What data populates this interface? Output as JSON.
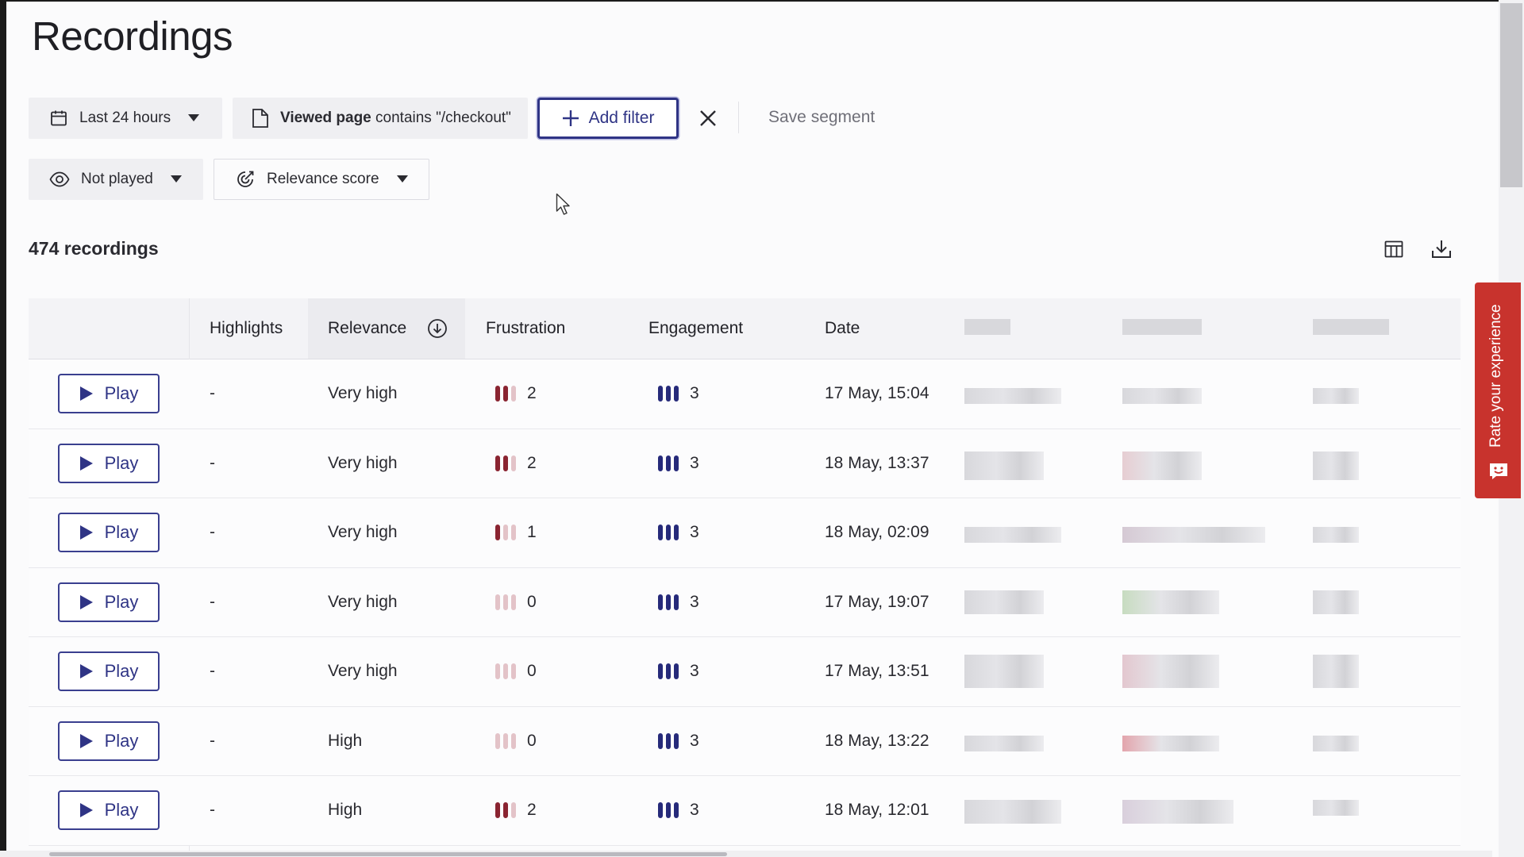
{
  "page": {
    "title": "Recordings"
  },
  "filters": {
    "date_range": "Last 24 hours",
    "page_filter": {
      "label": "Viewed page",
      "rest": " contains \"/checkout\""
    },
    "add_filter": "Add filter",
    "save_segment": "Save segment",
    "played_state": "Not played",
    "sort": "Relevance score"
  },
  "results": {
    "count_label": "474 recordings"
  },
  "table": {
    "columns": {
      "highlights": "Highlights",
      "relevance": "Relevance",
      "frustration": "Frustration",
      "engagement": "Engagement",
      "date": "Date"
    },
    "play_label": "Play",
    "rows": [
      {
        "highlights": "-",
        "relevance": "Very high",
        "frustration": "2",
        "engagement": "3",
        "date": "17 May, 15:04"
      },
      {
        "highlights": "-",
        "relevance": "Very high",
        "frustration": "2",
        "engagement": "3",
        "date": "18 May, 13:37"
      },
      {
        "highlights": "-",
        "relevance": "Very high",
        "frustration": "1",
        "engagement": "3",
        "date": "18 May, 02:09"
      },
      {
        "highlights": "-",
        "relevance": "Very high",
        "frustration": "0",
        "engagement": "3",
        "date": "17 May, 19:07"
      },
      {
        "highlights": "-",
        "relevance": "Very high",
        "frustration": "0",
        "engagement": "3",
        "date": "17 May, 13:51"
      },
      {
        "highlights": "-",
        "relevance": "High",
        "frustration": "0",
        "engagement": "3",
        "date": "18 May, 13:22"
      },
      {
        "highlights": "-",
        "relevance": "High",
        "frustration": "2",
        "engagement": "3",
        "date": "18 May, 12:01"
      }
    ]
  },
  "feedback": {
    "label": "Rate your experience"
  },
  "colors": {
    "accent": "#2f3485",
    "frustration_bar": "#8a2431",
    "frustration_bar_off": "#e3c3c8",
    "engagement_bar": "#262a7a",
    "feedback_tab": "#c8332d"
  },
  "icons": [
    "calendar-icon",
    "caret-down-icon",
    "page-icon",
    "plus-icon",
    "close-icon",
    "eye-icon",
    "relevance-icon",
    "columns-icon",
    "download-icon",
    "sort-desc-icon",
    "play-icon",
    "feedback-face-icon"
  ]
}
